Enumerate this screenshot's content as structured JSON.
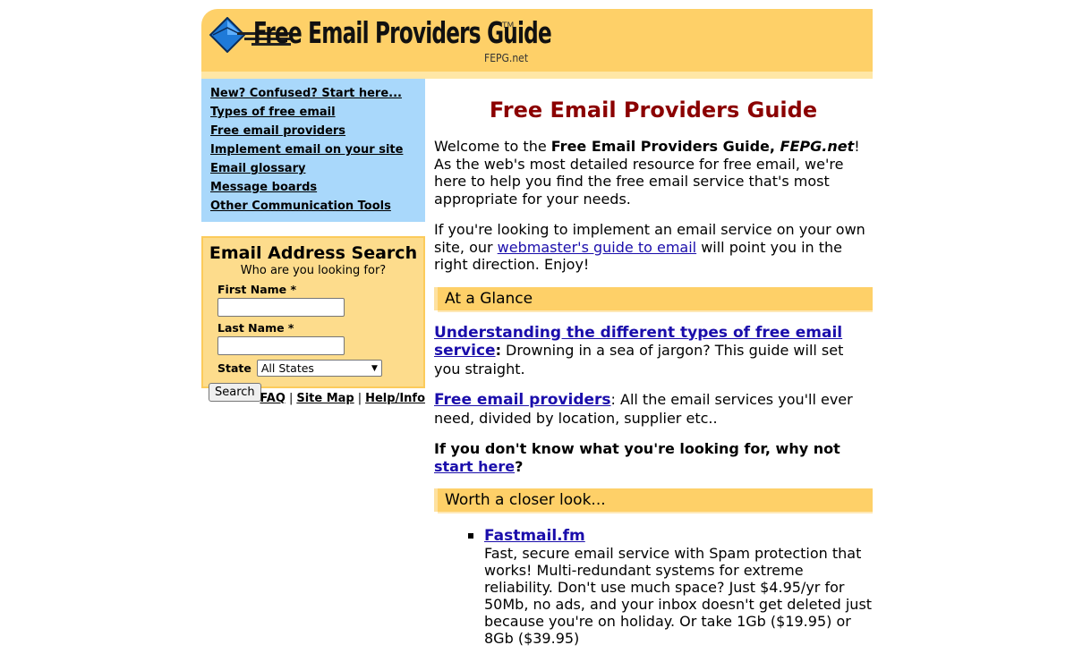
{
  "header": {
    "logo_text": "Free Email Providers Guide",
    "logo_tm": "TM",
    "logo_sub": "FEPG.net"
  },
  "sidebar": {
    "nav": [
      {
        "label": "New? Confused? Start here..."
      },
      {
        "label": "Types of free email"
      },
      {
        "label": "Free email providers"
      },
      {
        "label": "Implement email on your site"
      },
      {
        "label": "Email glossary"
      },
      {
        "label": "Message boards"
      },
      {
        "label": "Other Communication Tools"
      }
    ],
    "search": {
      "title": "Email Address Search",
      "subtitle": "Who are you looking for?",
      "first_name_label": "First Name *",
      "first_name_value": "",
      "last_name_label": "Last Name *",
      "last_name_value": "",
      "state_label": "State",
      "state_value": "All States",
      "button_label": "Search"
    },
    "footer": {
      "faq": "FAQ",
      "sitemap": "Site Map",
      "help": "Help/Info",
      "sep": "|"
    }
  },
  "content": {
    "title": "Free Email Providers Guide",
    "welcome": {
      "pre": "Welcome to the ",
      "bold1": "Free Email Providers Guide, ",
      "italic": "FEPG.net",
      "post": "! As the web's most detailed resource for free email, we're here to help you find the free email service that's most appropriate for your needs."
    },
    "webmaster": {
      "pre": "If you're looking to implement an email service on your own site, our ",
      "link": "webmaster's guide to email",
      "post": " will point you in the right direction. Enjoy!"
    },
    "glance_heading": "At a Glance",
    "glance_1": {
      "link": "Understanding the different types of free email service",
      "colon": ":",
      "text": " Drowning in a sea of jargon? This guide will set you straight."
    },
    "glance_2": {
      "link": "Free email providers",
      "text": ": All the email services you'll ever need, divided by location, supplier etc.."
    },
    "glance_3": {
      "pre": "If you don't know what you're looking for, why not ",
      "link": "start here",
      "post": "?"
    },
    "closer_heading": "Worth a closer look...",
    "closer_items": [
      {
        "name": "Fastmail.fm",
        "desc": "Fast, secure email service with Spam protection that works! Multi-redundant systems for extreme reliability. Don't use much space? Just $4.95/yr for 50Mb, no ads, and your inbox doesn't get deleted just because you're on holiday. Or take 1Gb ($19.95) or 8Gb ($39.95)"
      }
    ]
  },
  "colors": {
    "header_bg": "#fed068",
    "nav_bg": "#a9d8fb",
    "search_bg": "#fddc8c",
    "title_color": "#8b0000",
    "link_color": "#1a0dab"
  }
}
